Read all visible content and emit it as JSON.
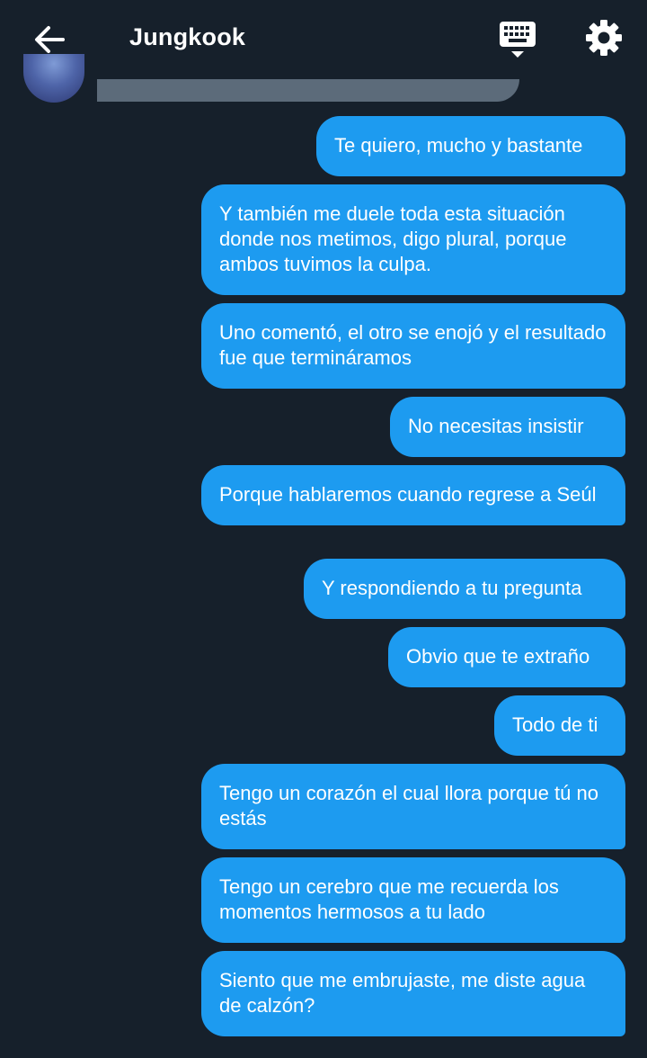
{
  "header": {
    "title": "Jungkook",
    "back_icon": "arrow-left-icon",
    "keyboard_icon": "keyboard-icon",
    "settings_icon": "gear-icon"
  },
  "colors": {
    "background": "#16202b",
    "bubble_sent": "#1d9bf0",
    "bubble_received": "#5c6b7a",
    "text": "#ffffff"
  },
  "messages": [
    {
      "text": "Te quiero, mucho y bastante"
    },
    {
      "text": "Y también me duele toda esta situación donde nos metimos, digo plural, porque ambos tuvimos la culpa."
    },
    {
      "text": "Uno comentó, el otro se enojó y el resultado fue que termináramos"
    },
    {
      "text": "No necesitas insistir"
    },
    {
      "text": "Porque hablaremos cuando regrese a Seúl"
    },
    {
      "text": "Y respondiendo a tu pregunta"
    },
    {
      "text": "Obvio que te extraño"
    },
    {
      "text": "Todo de ti"
    },
    {
      "text": "Tengo un corazón el cual llora porque tú no estás"
    },
    {
      "text": "Tengo un cerebro que me recuerda los momentos hermosos a tu lado"
    },
    {
      "text": "Siento que me embrujaste, me diste agua de calzón?"
    }
  ]
}
